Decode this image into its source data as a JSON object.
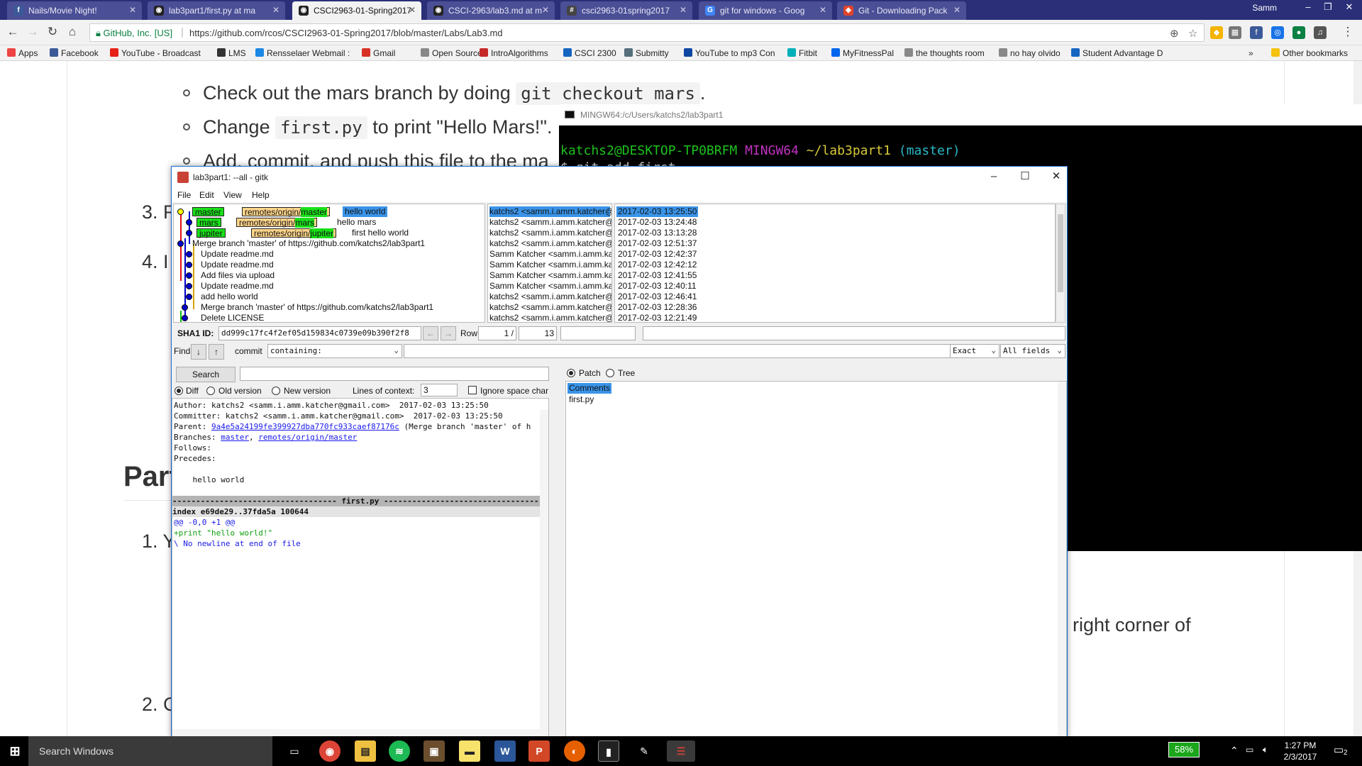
{
  "browser": {
    "tabs": [
      {
        "title": "Nails/Movie Night!",
        "icon": "facebook-icon",
        "color": "#3b5998",
        "glyph": "f"
      },
      {
        "title": "lab3part1/first.py at ma",
        "icon": "github-icon",
        "color": "#222222",
        "glyph": "◉"
      },
      {
        "title": "CSCI2963-01-Spring2017",
        "icon": "github-icon",
        "color": "#222222",
        "glyph": "◉"
      },
      {
        "title": "CSCI-2963/lab3.md at m",
        "icon": "github-icon",
        "color": "#222222",
        "glyph": "◉"
      },
      {
        "title": "csci2963-01spring2017",
        "icon": "hash-icon",
        "color": "#444444",
        "glyph": "#"
      },
      {
        "title": "git for windows - Goog",
        "icon": "google-icon",
        "color": "#4285f4",
        "glyph": "G"
      },
      {
        "title": "Git - Downloading Pack",
        "icon": "git-icon",
        "color": "#e24329",
        "glyph": "◆"
      }
    ],
    "user": "Samm",
    "secure_label": "GitHub, Inc. [US]",
    "url": "https://github.com/rcos/CSCI2963-01-Spring2017/blob/master/Labs/Lab3.md",
    "bookmarks": [
      {
        "label": "Apps",
        "color": "#e44"
      },
      {
        "label": "Facebook",
        "color": "#3b5998"
      },
      {
        "label": "YouTube - Broadcast",
        "color": "#e62117"
      },
      {
        "label": "LMS",
        "color": "#333"
      },
      {
        "label": "Rensselaer Webmail :",
        "color": "#1e88e5"
      },
      {
        "label": "Gmail",
        "color": "#d93025"
      },
      {
        "label": "Open Source",
        "color": "#888"
      },
      {
        "label": "IntroAlgorithms",
        "color": "#c62828"
      },
      {
        "label": "CSCI 2300",
        "color": "#1565c0"
      },
      {
        "label": "Submitty",
        "color": "#546e7a"
      },
      {
        "label": "YouTube to mp3 Con",
        "color": "#0d47a1"
      },
      {
        "label": "Fitbit",
        "color": "#00b0b9"
      },
      {
        "label": "MyFitnessPal",
        "color": "#0066ee"
      },
      {
        "label": "the thoughts room",
        "color": "#888"
      },
      {
        "label": "no hay olvido",
        "color": "#888"
      },
      {
        "label": "Student Advantage D",
        "color": "#1565c0"
      }
    ],
    "other_bookmarks": "Other bookmarks"
  },
  "page": {
    "bullet1_pre": "Check out the mars branch by doing",
    "bullet1_code": "git checkout mars",
    "bullet1_post": ".",
    "bullet2_pre": "Change",
    "bullet2_code": "first.py",
    "bullet2_post": "to print \"Hello Mars!\".",
    "bullet3": "Add, commit, and push this file to the ma",
    "item3": "3. R",
    "item4": "4. I",
    "heading": "Part",
    "item1": "1. Y",
    "item2": "2. C",
    "right_text": "right corner of"
  },
  "terminal": {
    "title": "MINGW64:/c/Users/katchs2/lab3part1",
    "user_host": "katchs2@DESKTOP-TP0BRFM",
    "shell": "MINGW64",
    "path": "~/lab3part1",
    "branch": "(master)",
    "cmd_partial": "git add first"
  },
  "gitk": {
    "title": "lab3part1: --all - gitk",
    "menu": [
      "File",
      "Edit",
      "View",
      "Help"
    ],
    "commits": [
      {
        "refs": [
          {
            "name": "master",
            "kind": "local"
          },
          {
            "prefix": "remotes/origin/",
            "name": "master",
            "kind": "remote"
          }
        ],
        "msg": "hello world",
        "author": "katchs2 <samm.i.amm.katcher@gma",
        "date": "2017-02-03 13:25:50"
      },
      {
        "refs": [
          {
            "name": "mars",
            "kind": "local"
          },
          {
            "prefix": "remotes/origin/",
            "name": "mars",
            "kind": "remote"
          }
        ],
        "msg": "hello mars",
        "author": "katchs2 <samm.i.amm.katcher@gma",
        "date": "2017-02-03 13:24:48"
      },
      {
        "refs": [
          {
            "name": "jupiter",
            "kind": "local"
          },
          {
            "prefix": "remotes/origin/",
            "name": "jupiter",
            "kind": "remote"
          }
        ],
        "msg": "first hello world",
        "author": "katchs2 <samm.i.amm.katcher@gma",
        "date": "2017-02-03 13:13:28"
      },
      {
        "refs": [],
        "msg": "Merge branch 'master' of https://github.com/katchs2/lab3part1",
        "author": "katchs2 <samm.i.amm.katcher@gma",
        "date": "2017-02-03 12:51:37"
      },
      {
        "refs": [],
        "msg": "Update readme.md",
        "author": "Samm Katcher <samm.i.amm.katcher",
        "date": "2017-02-03 12:42:37"
      },
      {
        "refs": [],
        "msg": "Update readme.md",
        "author": "Samm Katcher <samm.i.amm.katcher",
        "date": "2017-02-03 12:42:12"
      },
      {
        "refs": [],
        "msg": "Add files via upload",
        "author": "Samm Katcher <samm.i.amm.katcher",
        "date": "2017-02-03 12:41:55"
      },
      {
        "refs": [],
        "msg": "Update readme.md",
        "author": "Samm Katcher <samm.i.amm.katcher",
        "date": "2017-02-03 12:40:11"
      },
      {
        "refs": [],
        "msg": "add hello world",
        "author": "katchs2 <samm.i.amm.katcher@gma",
        "date": "2017-02-03 12:46:41"
      },
      {
        "refs": [],
        "msg": "Merge branch 'master' of https://github.com/katchs2/lab3part1",
        "author": "katchs2 <samm.i.amm.katcher@gma",
        "date": "2017-02-03 12:28:36"
      },
      {
        "refs": [],
        "msg": "Delete LICENSE",
        "author": "katchs2 <samm.i.amm.katcher@gma",
        "date": "2017-02-03 12:21:49"
      }
    ],
    "sha_label": "SHA1 ID:",
    "sha_value": "dd999c17fc4f2ef05d159834c0739e09b390f2f8",
    "row_label": "Row",
    "row_current": "1 /",
    "row_total": "13",
    "find_label": "Find",
    "commit_label": "commit",
    "find_type": "containing:",
    "find_mode": "Exact",
    "find_fields": "All fields",
    "search_button": "Search",
    "diff_label": "Diff",
    "old_version_label": "Old version",
    "new_version_label": "New version",
    "context_label": "Lines of context:",
    "context_value": "3",
    "ignore_space_label": "Ignore space chang",
    "patch_label": "Patch",
    "tree_label": "Tree",
    "files": [
      "Comments",
      "first.py"
    ],
    "details": {
      "author": "Author: katchs2 <samm.i.amm.katcher@gmail.com>  2017-02-03 13:25:50",
      "committer": "Committer: katchs2 <samm.i.amm.katcher@gmail.com>  2017-02-03 13:25:50",
      "parent_label": "Parent: ",
      "parent_hash": "9a4e5a24199fe399927dba770fc933caef87176c",
      "parent_rest": " (Merge branch 'master' of h",
      "branches_label": "Branches: ",
      "branch1": "master",
      "branch_sep": ", ",
      "branch2": "remotes/origin/master",
      "follows": "Follows:",
      "precedes": "Precedes:",
      "message": "    hello world",
      "file_header": "----------------------------------- first.py -----------------------------------",
      "index": "index e69de29..37fda5a 100644",
      "hunk": "@@ -0,0 +1 @@",
      "added": "+print \"hello world!\"",
      "nonewline": "\\ No newline at end of file"
    }
  },
  "taskbar": {
    "search": "Search Windows",
    "battery": "58%",
    "time": "1:27 PM",
    "date": "2/3/2017",
    "notifications": "2"
  }
}
